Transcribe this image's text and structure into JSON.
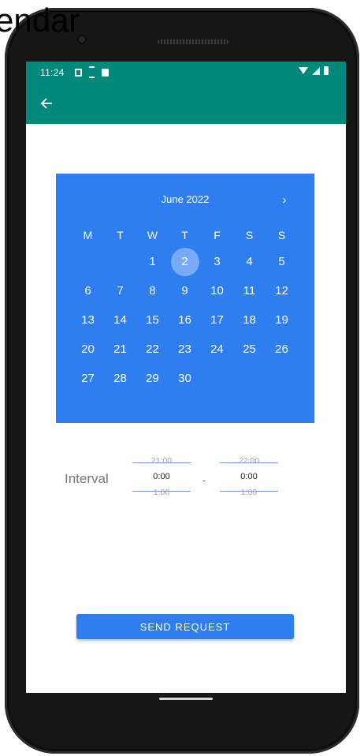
{
  "page_heading": "endar",
  "status_bar": {
    "time": "11:24"
  },
  "calendar": {
    "month_label": "June 2022",
    "next_arrow": "›",
    "weekdays": [
      "M",
      "T",
      "W",
      "T",
      "F",
      "S",
      "S"
    ],
    "leading_blank_days": 2,
    "days": [
      "1",
      "2",
      "3",
      "4",
      "5",
      "6",
      "7",
      "8",
      "9",
      "10",
      "11",
      "12",
      "13",
      "14",
      "15",
      "16",
      "17",
      "18",
      "19",
      "20",
      "21",
      "22",
      "23",
      "24",
      "25",
      "26",
      "27",
      "28",
      "29",
      "30"
    ],
    "selected_day": "2"
  },
  "interval": {
    "label": "Interval",
    "separator": "-",
    "start": {
      "prev": "21:00",
      "current": "0:00",
      "next": "1:00"
    },
    "end": {
      "prev": "22:00",
      "current": "0:00",
      "next": "1:00"
    }
  },
  "actions": {
    "send_label": "SEND REQUEST"
  },
  "colors": {
    "app_bar": "#00897b",
    "primary": "#2f7ef0"
  }
}
